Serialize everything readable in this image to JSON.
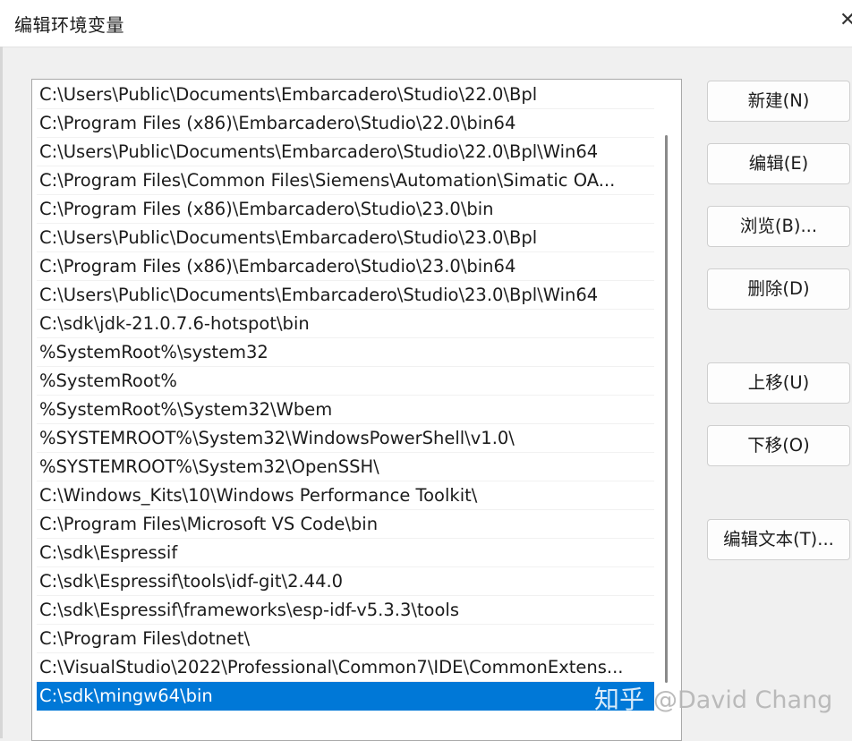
{
  "window": {
    "title": "编辑环境变量"
  },
  "path_list": [
    "C:\\Users\\Public\\Documents\\Embarcadero\\Studio\\22.0\\Bpl",
    "C:\\Program Files (x86)\\Embarcadero\\Studio\\22.0\\bin64",
    "C:\\Users\\Public\\Documents\\Embarcadero\\Studio\\22.0\\Bpl\\Win64",
    "C:\\Program Files\\Common Files\\Siemens\\Automation\\Simatic OA...",
    "C:\\Program Files (x86)\\Embarcadero\\Studio\\23.0\\bin",
    "C:\\Users\\Public\\Documents\\Embarcadero\\Studio\\23.0\\Bpl",
    "C:\\Program Files (x86)\\Embarcadero\\Studio\\23.0\\bin64",
    "C:\\Users\\Public\\Documents\\Embarcadero\\Studio\\23.0\\Bpl\\Win64",
    "C:\\sdk\\jdk-21.0.7.6-hotspot\\bin",
    "%SystemRoot%\\system32",
    "%SystemRoot%",
    "%SystemRoot%\\System32\\Wbem",
    "%SYSTEMROOT%\\System32\\WindowsPowerShell\\v1.0\\",
    "%SYSTEMROOT%\\System32\\OpenSSH\\",
    "C:\\Windows_Kits\\10\\Windows Performance Toolkit\\",
    "C:\\Program Files\\Microsoft VS Code\\bin",
    "C:\\sdk\\Espressif",
    "C:\\sdk\\Espressif\\tools\\idf-git\\2.44.0",
    "C:\\sdk\\Espressif\\frameworks\\esp-idf-v5.3.3\\tools",
    "C:\\Program Files\\dotnet\\",
    "C:\\VisualStudio\\2022\\Professional\\Common7\\IDE\\CommonExtens...",
    "C:\\sdk\\mingw64\\bin"
  ],
  "selected_index": 21,
  "buttons": {
    "new": "新建(N)",
    "edit": "编辑(E)",
    "browse": "浏览(B)...",
    "delete": "删除(D)",
    "move_up": "上移(U)",
    "move_down": "下移(O)",
    "edit_text": "编辑文本(T)..."
  },
  "watermark": {
    "site": "知乎",
    "user": "@David Chang"
  },
  "colors": {
    "selection": "#0078d7",
    "background": "#f0f0f0"
  }
}
